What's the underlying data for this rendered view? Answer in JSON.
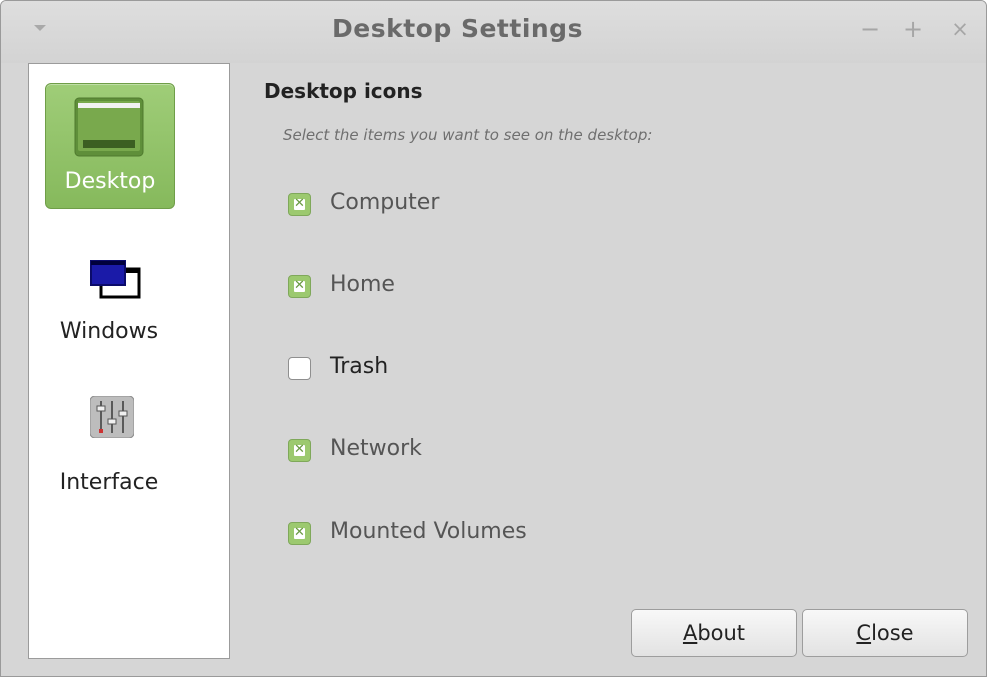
{
  "window": {
    "title": "Desktop Settings",
    "controls": {
      "minimize": "−",
      "maximize": "+",
      "close": "×"
    }
  },
  "sidebar": {
    "items": [
      {
        "label": "Desktop",
        "icon": "desktop-icon",
        "active": true
      },
      {
        "label": "Windows",
        "icon": "windows-icon",
        "active": false
      },
      {
        "label": "Interface",
        "icon": "interface-mixer-icon",
        "active": false
      }
    ]
  },
  "content": {
    "section_title": "Desktop icons",
    "subtitle": "Select the items you want to see on the desktop:",
    "checkboxes": [
      {
        "label": "Computer",
        "checked": true
      },
      {
        "label": "Home",
        "checked": true
      },
      {
        "label": "Trash",
        "checked": false
      },
      {
        "label": "Network",
        "checked": true
      },
      {
        "label": "Mounted Volumes",
        "checked": true
      }
    ]
  },
  "buttons": {
    "about": {
      "mnemonic": "A",
      "rest": "bout"
    },
    "close": {
      "mnemonic": "C",
      "rest": "lose"
    }
  },
  "colors": {
    "accent_green": "#8fc265",
    "window_bg": "#d6d6d6"
  }
}
